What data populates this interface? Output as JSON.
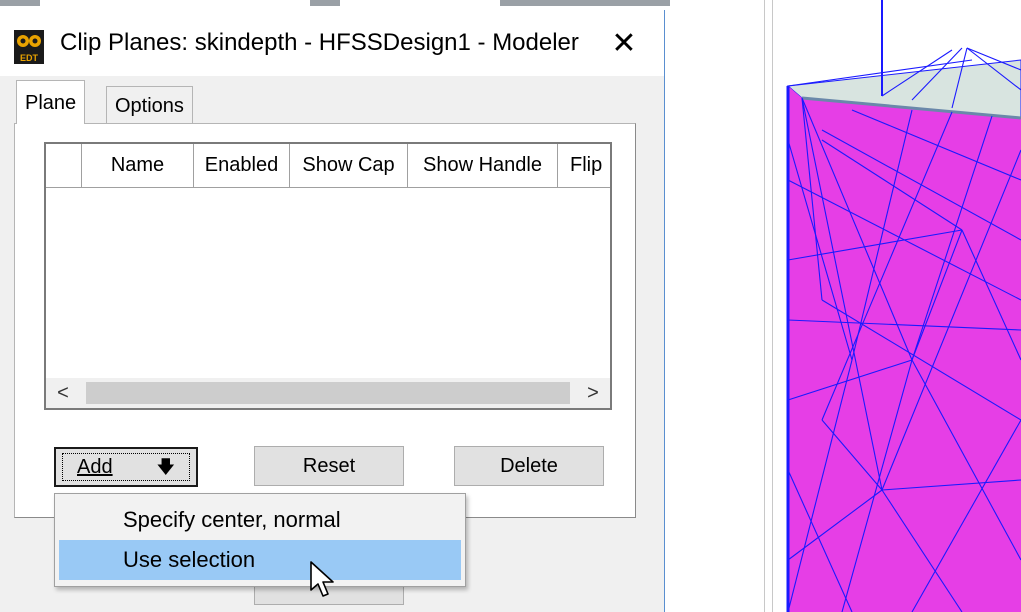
{
  "dialog": {
    "title": "Clip Planes: skindepth - HFSSDesign1 - Modeler",
    "close_label": "✕",
    "app_icon_text": "EDT"
  },
  "tabs": [
    {
      "label": "Plane",
      "active": true
    },
    {
      "label": "Options",
      "active": false
    }
  ],
  "table": {
    "columns": [
      "",
      "Name",
      "Enabled",
      "Show Cap",
      "Show Handle",
      "Flip"
    ],
    "rows": [],
    "scroll_left": "<",
    "scroll_right": ">"
  },
  "buttons": {
    "add_label": "Add",
    "add_arrow": "🡇",
    "reset_label": "Reset",
    "delete_label": "Delete"
  },
  "menu": {
    "items": [
      {
        "label": "Specify center, normal",
        "highlighted": false
      },
      {
        "label": "Use selection",
        "highlighted": true
      }
    ]
  },
  "colors": {
    "menu_highlight": "#99c9f5",
    "mesh_face": "#e63ee6",
    "mesh_lines": "#1a1aff",
    "mesh_top": "#d8e4e0"
  }
}
